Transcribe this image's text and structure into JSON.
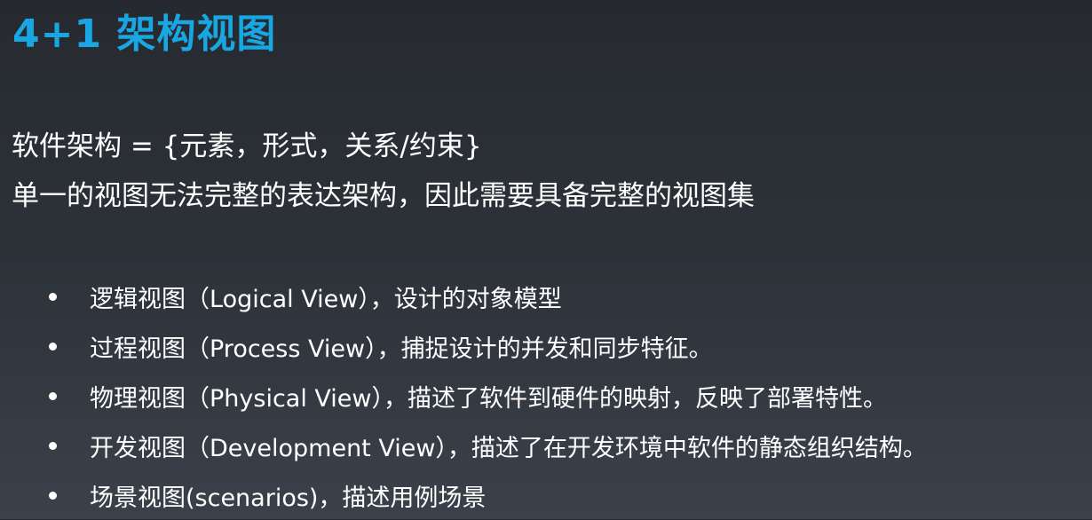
{
  "slide": {
    "title": "4+1 架构视图",
    "intro": [
      "软件架构  = {元素，形式，关系/约束}",
      "单一的视图无法完整的表达架构，因此需要具备完整的视图集"
    ],
    "bullets": [
      "逻辑视图（Logical View），设计的对象模型",
      "过程视图（Process View），捕捉设计的并发和同步特征。",
      "物理视图（Physical View），描述了软件到硬件的映射，反映了部署特性。",
      "开发视图（Development View），描述了在开发环境中软件的静态组织结构。",
      "场景视图(scenarios)，描述用例场景"
    ]
  },
  "colors": {
    "title": "#18a7e3",
    "text": "#ffffff",
    "background_top": "#262a30",
    "background_bottom": "#3b414a"
  }
}
